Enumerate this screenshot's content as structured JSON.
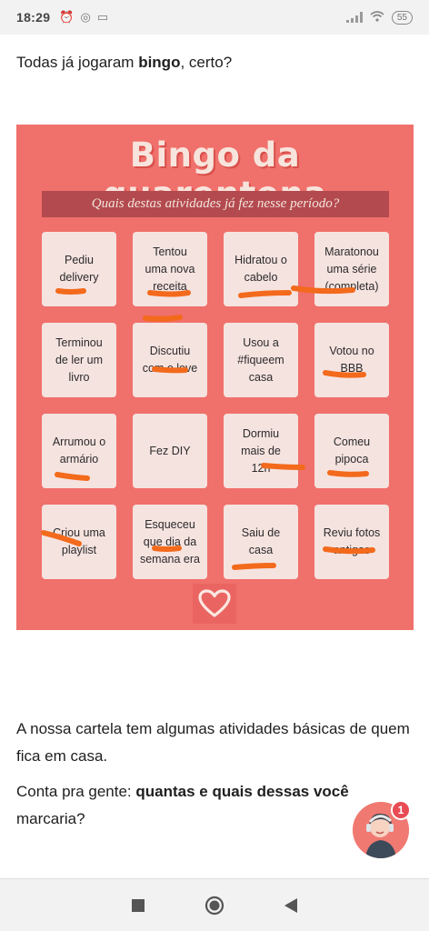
{
  "status_bar": {
    "time": "18:29",
    "battery": "55"
  },
  "intro": {
    "before": "Todas já jogaram ",
    "bold": "bingo",
    "after": ", certo?"
  },
  "card": {
    "title": "Bingo da quarentena",
    "subtitle": "Quais destas atividades já fez nesse período?",
    "cells": [
      "Pediu\ndelivery",
      "Tentou\numa nova\nreceita",
      "Hidratou o\ncabelo",
      "Maratonou\numa série\n(completa)",
      "Terminou\nde ler um\nlivro",
      "Discutiu\ncom o love",
      "Usou a\n#fiqueem\ncasa",
      "Votou no\nBBB",
      "Arrumou o\narmário",
      "Fez DIY",
      "Dormiu\nmais de\n12h",
      "Comeu\npipoca",
      "Criou uma\nplaylist",
      "Esqueceu\nque dia da\nsemana era",
      "Saiu de\ncasa",
      "Reviu fotos\nantigas"
    ]
  },
  "para1": "A nossa cartela tem algumas atividades básicas de quem fica em casa.",
  "para2": {
    "before": "Conta pra gente: ",
    "bold": "quantas e quais dessas você",
    "after": " marcaria?"
  },
  "chat_badge": "1",
  "colors": {
    "card_bg": "#f0706b",
    "mark_stroke": "#f36a1c",
    "subtitle_bg": "#b34a4f"
  }
}
